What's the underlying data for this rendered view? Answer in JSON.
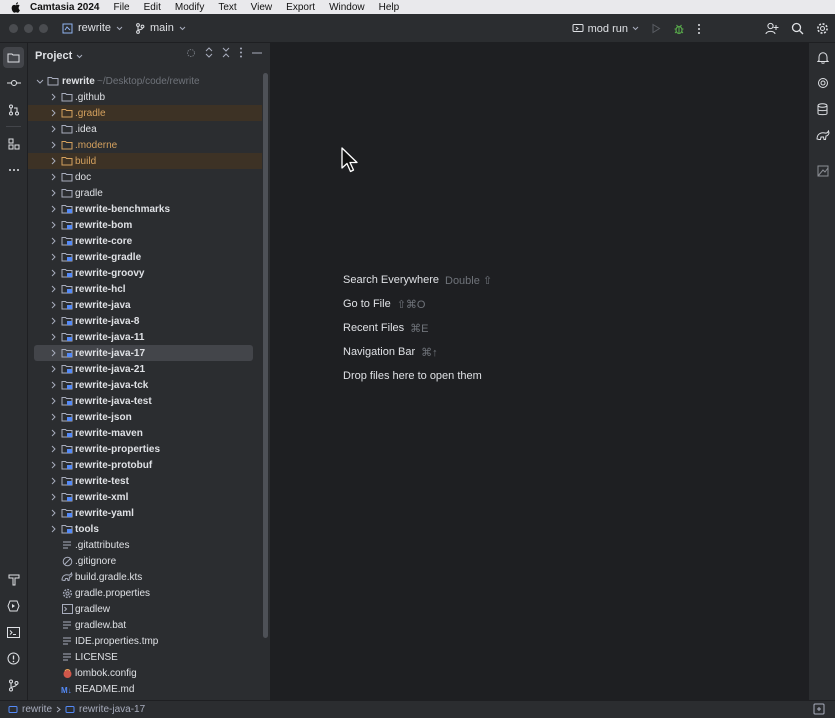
{
  "menubar": {
    "app_name": "Camtasia 2024",
    "items": [
      "File",
      "Edit",
      "Modify",
      "Text",
      "View",
      "Export",
      "Window",
      "Help"
    ]
  },
  "titlebar": {
    "project": "rewrite",
    "branch": "main",
    "run_config": "mod run"
  },
  "project_panel": {
    "title": "Project",
    "root": {
      "name": "rewrite",
      "path": "~/Desktop/code/rewrite"
    },
    "items": [
      {
        "label": ".github"
      },
      {
        "label": ".gradle"
      },
      {
        "label": ".idea"
      },
      {
        "label": ".moderne"
      },
      {
        "label": "build"
      },
      {
        "label": "doc"
      },
      {
        "label": "gradle"
      },
      {
        "label": "rewrite-benchmarks"
      },
      {
        "label": "rewrite-bom"
      },
      {
        "label": "rewrite-core"
      },
      {
        "label": "rewrite-gradle"
      },
      {
        "label": "rewrite-groovy"
      },
      {
        "label": "rewrite-hcl"
      },
      {
        "label": "rewrite-java"
      },
      {
        "label": "rewrite-java-8"
      },
      {
        "label": "rewrite-java-11"
      },
      {
        "label": "rewrite-java-17"
      },
      {
        "label": "rewrite-java-21"
      },
      {
        "label": "rewrite-java-tck"
      },
      {
        "label": "rewrite-java-test"
      },
      {
        "label": "rewrite-json"
      },
      {
        "label": "rewrite-maven"
      },
      {
        "label": "rewrite-properties"
      },
      {
        "label": "rewrite-protobuf"
      },
      {
        "label": "rewrite-test"
      },
      {
        "label": "rewrite-xml"
      },
      {
        "label": "rewrite-yaml"
      },
      {
        "label": "tools"
      },
      {
        "label": ".gitattributes"
      },
      {
        "label": ".gitignore"
      },
      {
        "label": "build.gradle.kts"
      },
      {
        "label": "gradle.properties"
      },
      {
        "label": "gradlew"
      },
      {
        "label": "gradlew.bat"
      },
      {
        "label": "IDE.properties.tmp"
      },
      {
        "label": "LICENSE"
      },
      {
        "label": "lombok.config"
      },
      {
        "label": "README.md"
      }
    ]
  },
  "editor": {
    "hints": [
      {
        "label": "Search Everywhere",
        "shortcut": "Double ⇧"
      },
      {
        "label": "Go to File",
        "shortcut": "⇧⌘O"
      },
      {
        "label": "Recent Files",
        "shortcut": "⌘E"
      },
      {
        "label": "Navigation Bar",
        "shortcut": "⌘↑"
      },
      {
        "label": "Drop files here to open them",
        "shortcut": ""
      }
    ]
  },
  "statusbar": {
    "crumb_project": "rewrite",
    "crumb_module": "rewrite-java-17"
  },
  "colors": {
    "background": "#1e1f22",
    "panel": "#2b2d30",
    "excluded_text": "#d5a15e",
    "module_icon": "#548af7"
  }
}
